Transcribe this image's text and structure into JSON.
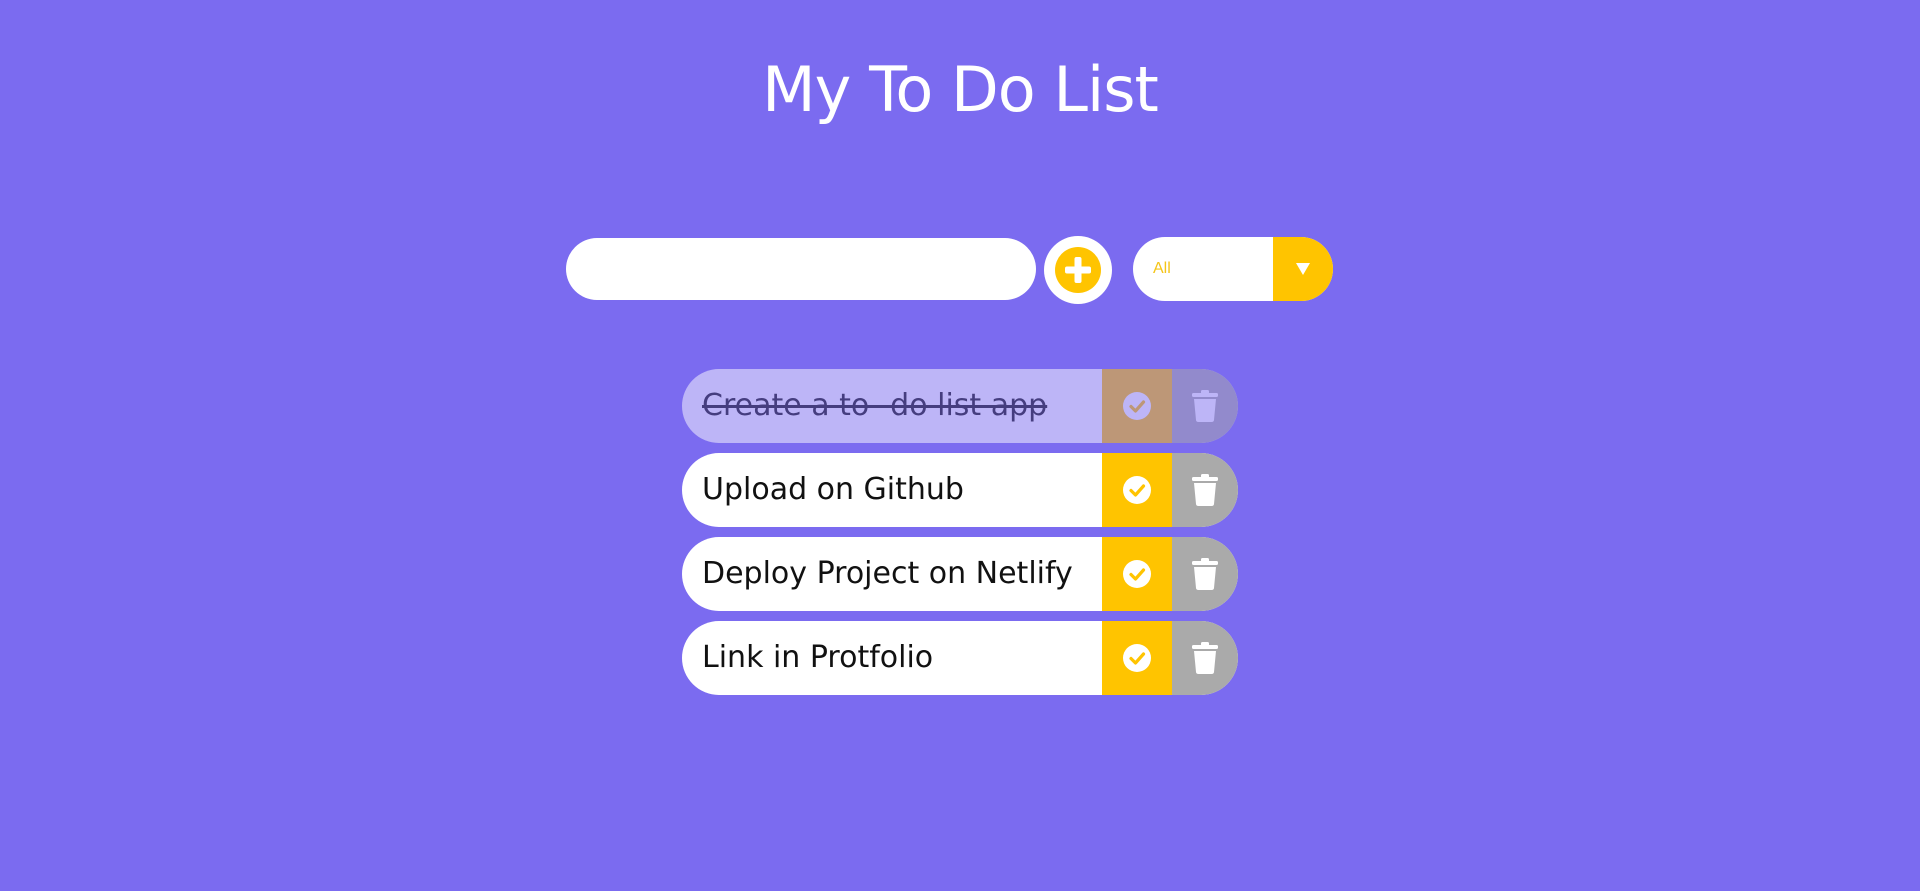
{
  "app": {
    "title": "My To Do List"
  },
  "toolbar": {
    "input_value": "",
    "input_placeholder": "",
    "add_icon": "plus-circle-icon",
    "filter": {
      "selected": "All",
      "icon": "caret-down-icon"
    }
  },
  "todos": [
    {
      "text": "Create a to- do list app",
      "completed": true
    },
    {
      "text": "Upload on Github",
      "completed": false
    },
    {
      "text": "Deploy Project on Netlify",
      "completed": false
    },
    {
      "text": "Link in Protfolio",
      "completed": false
    }
  ],
  "colors": {
    "background": "#7b6bf0",
    "accent": "#ffc400",
    "delete": "#aaaaaa",
    "text_primary": "#ffffff"
  }
}
